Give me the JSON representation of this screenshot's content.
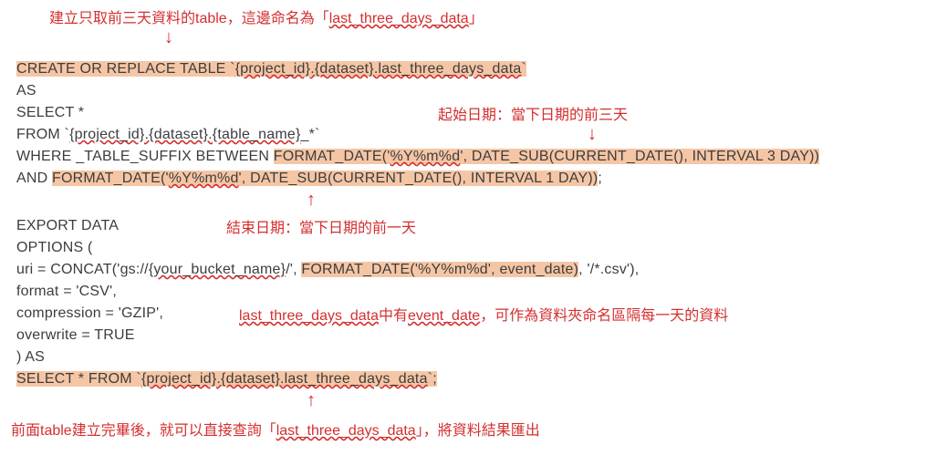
{
  "annotations": {
    "top": "建立只取前三天資料的table，這邊命名為「",
    "top_u": "last_three_days_data",
    "top_end": "」",
    "start_date": "起始日期：當下日期的前三天",
    "end_date": "結束日期：當下日期的前一天",
    "event_date_pre": "last_three_days_data",
    "event_date_mid": "中有",
    "event_date_u2": "event_date",
    "event_date_post": "，可作為資料夾命名區隔每一天的資料",
    "bottom": "前面table建立完畢後，就可以直接查詢「",
    "bottom_u": "last_three_days_data",
    "bottom_end": "」，將資料結果匯出"
  },
  "code": {
    "l1_a": "CREATE OR REPLACE TABLE `",
    "l1_b": "{project_id}.{dataset}.last_three_days_data",
    "l1_c": "`",
    "l2": "AS",
    "l3": "SELECT *",
    "l4_a": "FROM `",
    "l4_b": "{project_id}.{dataset}.{table_name}",
    "l4_c": "_*`",
    "l5_a": "WHERE _TABLE_SUFFIX BETWEEN ",
    "l5_b": "FORMAT_DATE('",
    "l5_c": "%Y%m%d",
    "l5_d": "', DATE_SUB(CURRENT_DATE(), INTERVAL 3 DAY))",
    "l6_a": "AND ",
    "l6_b": "FORMAT_DATE('",
    "l6_c": "%Y%m%d",
    "l6_d": "', DATE_SUB(CURRENT_DATE(), INTERVAL 1 DAY))",
    "l6_e": ";",
    "l8": "EXPORT DATA",
    "l9": "OPTIONS (",
    "l10_a": "  uri = CONCAT('gs://",
    "l10_b": "{your_bucket_name}",
    "l10_c": "/', ",
    "l10_d": "FORMAT_DATE('%Y%m%d', event_date)",
    "l10_e": ", '/*.csv'),",
    "l11": "  format = 'CSV',",
    "l12": "  compression = 'GZIP',",
    "l13": "  overwrite = TRUE",
    "l14": ") AS ",
    "l15_a": "SELECT * FROM `",
    "l15_b": "{project_id}.{dataset}.last_three_days_data",
    "l15_c": "`;"
  },
  "arrows": {
    "down": "↓",
    "up": "↑"
  }
}
